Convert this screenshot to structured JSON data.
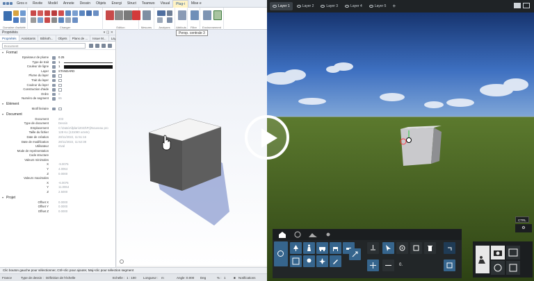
{
  "cad": {
    "ribbon_tabs": [
      "Gros o",
      "Revite",
      "Modèl",
      "Annote",
      "Dessin",
      "Objets",
      "Energi",
      "Struct",
      "Teamwo",
      "Visual",
      "Plug-i",
      "Mise e"
    ],
    "active_tab_index": 10,
    "ribbon_groups": [
      "Domaine d'activité",
      "Changer",
      "Edition",
      "Mesures",
      "Analyses",
      "Attributs",
      "Filtre",
      "Environnement"
    ],
    "tooltip": "Persp. centrale 3",
    "props": {
      "title": "Propriétés",
      "tabs": [
        "Propriétés",
        "Assistants",
        "Biblioth...",
        "Objets",
        "Plans de ...",
        "Issue M...",
        "Layer"
      ],
      "search_placeholder": "Document",
      "sections": {
        "format": "Format",
        "element": "Elément",
        "document": "Document",
        "projet": "Projet"
      },
      "format_rows": [
        {
          "label": "Epaisseur de plume",
          "value": "0.25"
        },
        {
          "label": "Type de trait",
          "value": "1"
        },
        {
          "label": "Couleur de ligne",
          "value": "1"
        },
        {
          "label": "Layer",
          "value": "STANDARD"
        },
        {
          "label": "Plume du layer",
          "value": ""
        },
        {
          "label": "Trait du layer",
          "value": ""
        },
        {
          "label": "Couleur du layer",
          "value": ""
        },
        {
          "label": "Construction d'aide",
          "value": ""
        },
        {
          "label": "Ordre",
          "value": "0"
        },
        {
          "label": "Numéro de segment",
          "value": "65"
        }
      ],
      "element_rows": [
        {
          "label": "Motif linéaire",
          "value": ""
        }
      ],
      "document_rows": [
        {
          "label": "Document",
          "value": "203"
        },
        {
          "label": "Type de document",
          "value": "Dessin"
        },
        {
          "label": "Emplacement",
          "value": "C:\\Data\\Allplan\\2023\\Prj\\Nouveau pro"
        },
        {
          "label": "Taille du fichier",
          "value": "128 Ko (131090 octets)"
        },
        {
          "label": "Date de création",
          "value": "28/11/2022, 11:51:16"
        },
        {
          "label": "Date de modification",
          "value": "28/11/2022, 11:52:38"
        },
        {
          "label": "Utilisateur",
          "value": "ntval"
        },
        {
          "label": "Mode de représentation",
          "value": ""
        },
        {
          "label": "Code structure",
          "value": ""
        },
        {
          "label": "Valeurs minimales",
          "value": ""
        },
        {
          "label": "X",
          "value": "-9.0076"
        },
        {
          "label": "Y",
          "value": "4.0064"
        },
        {
          "label": "Z",
          "value": "0.0000"
        },
        {
          "label": "Valeurs maximales",
          "value": ""
        },
        {
          "label": "X",
          "value": "-6.0076"
        },
        {
          "label": "Y",
          "value": "11.0064"
        },
        {
          "label": "Z",
          "value": "2.5000"
        }
      ],
      "projet_rows": [
        {
          "label": "Offset X",
          "value": "0.0000"
        },
        {
          "label": "Offset Y",
          "value": "0.0000"
        },
        {
          "label": "Offset Z",
          "value": "0.0000"
        }
      ]
    },
    "hint": "Clic bouton gauche pour sélectionner, Ctrl+clic pour ajouter, Maj+clic pour sélection segment",
    "status": {
      "country": "France",
      "drawing_type_label": "Type de dessin :",
      "drawing_type_value": "Définition de l'échelle",
      "scale_label": "Echelle :",
      "scale_value": "1 : 100",
      "length_label": "Longueur :",
      "length_value": "m",
      "angle_label": "Angle :",
      "angle_value": "0.000",
      "angle_unit": "Deg",
      "percent_label": "% :",
      "percent_value": "1",
      "notifications": "Notifications"
    }
  },
  "rt": {
    "layers": [
      "Layer 1",
      "Layer 2",
      "Layer 3",
      "Layer 4",
      "Layer 5"
    ],
    "active_layer_index": 0,
    "add_layer": "+",
    "ctrl_badge": "CTRL",
    "toolbar_value": "0.",
    "side_value": "⚙"
  },
  "colors": {
    "sky_top": "#1b3f8c",
    "grass": "#3f5a1c",
    "accent_blue": "#36658d"
  },
  "icons": {
    "play": "play-icon",
    "cursor": "hand-cursor-icon"
  }
}
